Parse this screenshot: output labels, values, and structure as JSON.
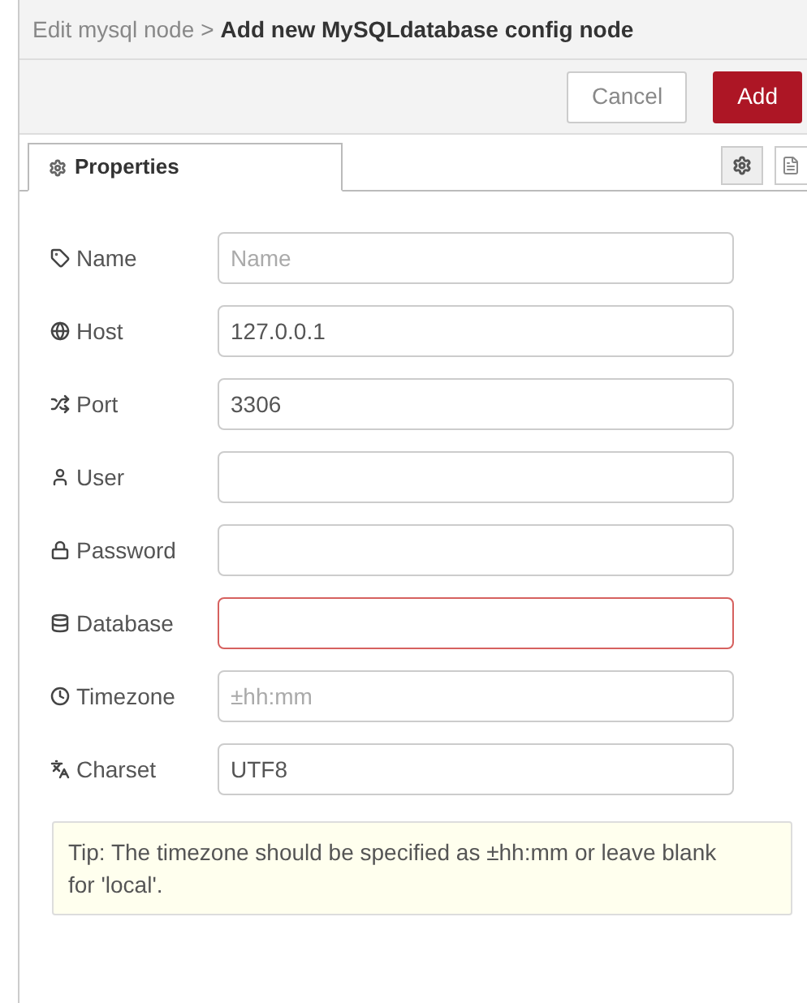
{
  "breadcrumb": {
    "parent": "Edit mysql node",
    "separator": ">",
    "current": "Add new MySQLdatabase config node"
  },
  "buttons": [
    {
      "label": "Cancel",
      "kind": "secondary"
    },
    {
      "label": "Add",
      "kind": "primary"
    }
  ],
  "tabs": [
    {
      "label": "Properties",
      "selected": true
    }
  ],
  "fields": [
    {
      "label": "Name",
      "placeholder": "Name",
      "invalid": false
    },
    {
      "label": "Host",
      "value": "127.0.0.1",
      "invalid": false
    },
    {
      "label": "Port",
      "value": "3306",
      "invalid": false
    },
    {
      "label": "User",
      "invalid": false
    },
    {
      "label": "Password",
      "invalid": false
    },
    {
      "label": "Database",
      "invalid": true
    },
    {
      "label": "Timezone",
      "placeholder": "±hh:mm",
      "invalid": false
    },
    {
      "label": "Charset",
      "value": "UTF8",
      "invalid": false
    }
  ],
  "tip": "Tip: The timezone should be specified as ±hh:mm or leave blank for 'local'."
}
